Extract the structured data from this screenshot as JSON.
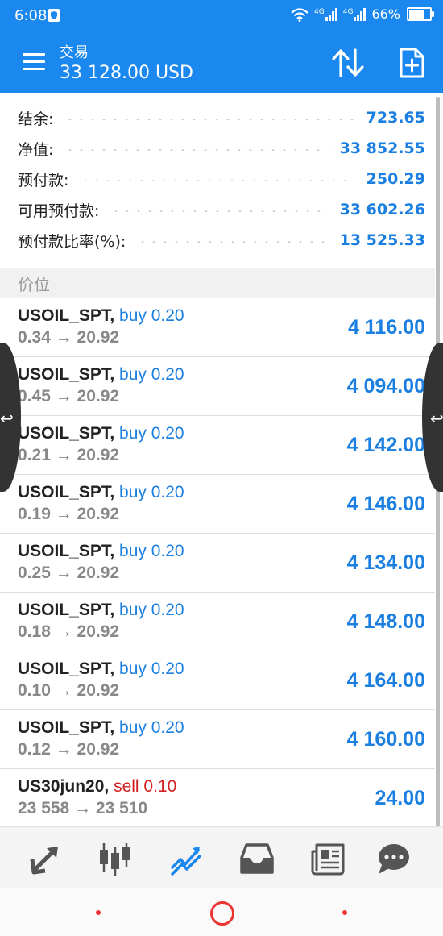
{
  "status_bar": {
    "time": "6:08",
    "network_1": "4G",
    "network_2": "4G",
    "battery": "66%",
    "battery_level": 0.66
  },
  "header": {
    "title": "交易",
    "balance_line": "33 128.00 USD",
    "accent_color": "#1a88ee"
  },
  "summary": [
    {
      "label": "结余:",
      "value": "723.65"
    },
    {
      "label": "净值:",
      "value": "33 852.55"
    },
    {
      "label": "预付款:",
      "value": "250.29"
    },
    {
      "label": "可用预付款:",
      "value": "33 602.26"
    },
    {
      "label": "预付款比率(%):",
      "value": "13 525.33"
    }
  ],
  "section_label": "价位",
  "positions": [
    {
      "symbol": "USOIL_SPT,",
      "action": "buy 0.20",
      "side": "buy",
      "prices": "0.34 → 20.92",
      "profit": "4 116.00"
    },
    {
      "symbol": "USOIL_SPT,",
      "action": "buy 0.20",
      "side": "buy",
      "prices": "0.45 → 20.92",
      "profit": "4 094.00"
    },
    {
      "symbol": "USOIL_SPT,",
      "action": "buy 0.20",
      "side": "buy",
      "prices": "0.21 → 20.92",
      "profit": "4 142.00"
    },
    {
      "symbol": "USOIL_SPT,",
      "action": "buy 0.20",
      "side": "buy",
      "prices": "0.19 → 20.92",
      "profit": "4 146.00"
    },
    {
      "symbol": "USOIL_SPT,",
      "action": "buy 0.20",
      "side": "buy",
      "prices": "0.25 → 20.92",
      "profit": "4 134.00"
    },
    {
      "symbol": "USOIL_SPT,",
      "action": "buy 0.20",
      "side": "buy",
      "prices": "0.18 → 20.92",
      "profit": "4 148.00"
    },
    {
      "symbol": "USOIL_SPT,",
      "action": "buy 0.20",
      "side": "buy",
      "prices": "0.10 → 20.92",
      "profit": "4 164.00"
    },
    {
      "symbol": "USOIL_SPT,",
      "action": "buy 0.20",
      "side": "buy",
      "prices": "0.12 → 20.92",
      "profit": "4 160.00"
    },
    {
      "symbol": "US30jun20,",
      "action": "sell 0.10",
      "side": "sell",
      "prices": "23 558 → 23 510",
      "profit": "24.00"
    }
  ],
  "bottom_nav": [
    {
      "icon": "quotes-icon",
      "active": false
    },
    {
      "icon": "chart-icon",
      "active": false
    },
    {
      "icon": "trade-icon",
      "active": true
    },
    {
      "icon": "history-icon",
      "active": false
    },
    {
      "icon": "news-icon",
      "active": false
    },
    {
      "icon": "chat-icon",
      "active": false
    }
  ],
  "colors": {
    "profit": "#1a7fe0",
    "buy": "#1a7fe0",
    "sell": "#d22020",
    "nav_active": "#1a88ee",
    "nav_inactive": "#555555"
  }
}
